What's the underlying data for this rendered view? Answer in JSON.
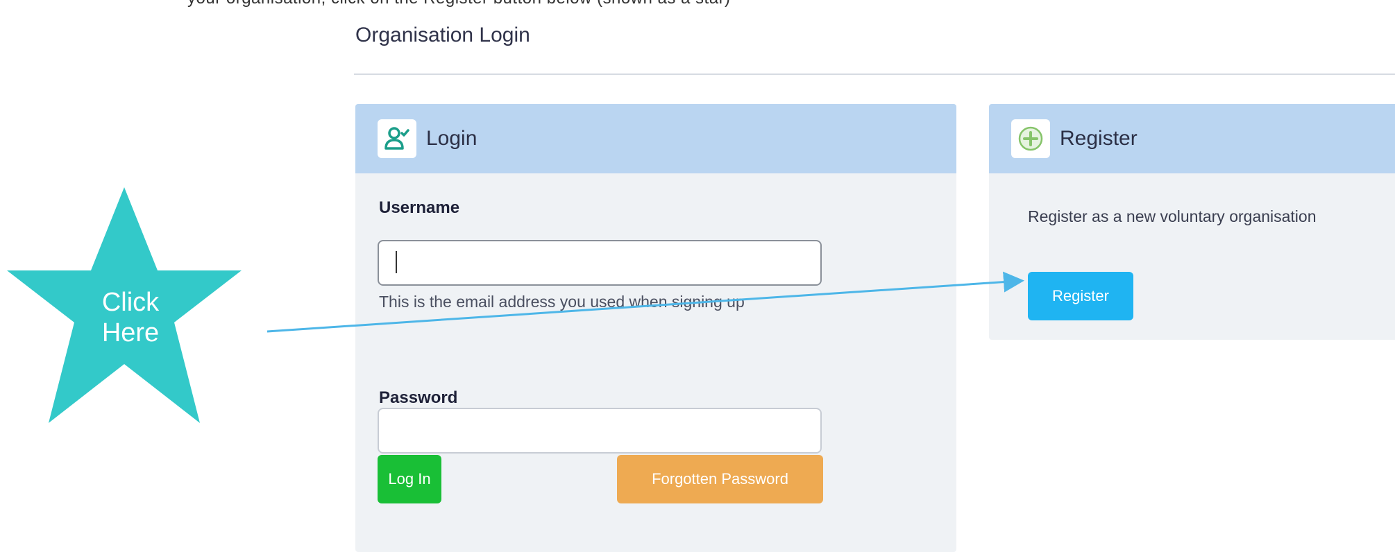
{
  "top_cut_text": "your organisation, click on the Register button below (shown as a star)",
  "page_title": "Organisation Login",
  "login": {
    "header_label": "Login",
    "header_icon": "user-check-icon",
    "username_label": "Username",
    "username_value": "",
    "username_help": "This is the email address you used when signing up",
    "password_label": "Password",
    "password_value": "",
    "login_button": "Log In",
    "forgot_button": "Forgotten Password"
  },
  "register": {
    "header_label": "Register",
    "header_icon": "plus-circle-icon",
    "description": "Register as a new voluntary organisation",
    "register_button": "Register"
  },
  "annotation": {
    "star_text_line1": "Click",
    "star_text_line2": "Here",
    "star_color": "#33c9c9",
    "arrow_color": "#4db6e8"
  },
  "colors": {
    "header_bg": "#bad5f1",
    "panel_bg": "#eff2f5",
    "login_button": "#19bf36",
    "forgot_button": "#eeaa52",
    "register_button": "#1fb4f2"
  }
}
